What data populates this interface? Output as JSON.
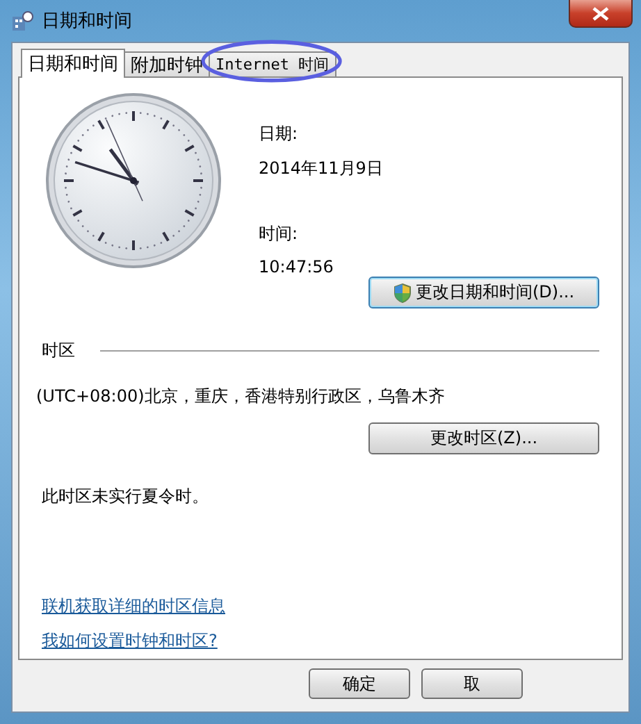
{
  "window": {
    "title": "日期和时间"
  },
  "tabs": [
    {
      "label": "日期和时间",
      "selected": true
    },
    {
      "label": "附加时钟",
      "selected": false
    },
    {
      "label": "Internet 时间",
      "selected": false,
      "circled": true
    }
  ],
  "date": {
    "label": "日期:",
    "value": "2014年11月9日"
  },
  "time": {
    "label": "时间:",
    "value": "10:47:56"
  },
  "change_datetime_button": {
    "label": "更改日期和时间(D)...",
    "shield": true
  },
  "timezone": {
    "heading": "时区",
    "value": "(UTC+08:00)北京，重庆，香港特别行政区，乌鲁木齐",
    "button": "更改时区(Z)...",
    "dst_note": "此时区未实行夏令时。"
  },
  "links": [
    "联机获取详细的时区信息",
    "我如何设置时钟和时区?"
  ],
  "buttons": [
    "确定",
    "取"
  ]
}
